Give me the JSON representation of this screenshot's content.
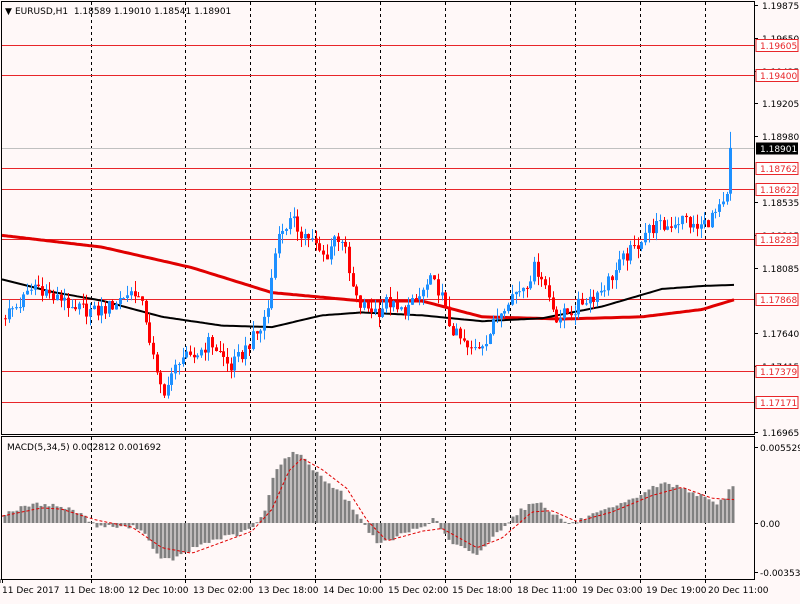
{
  "colors": {
    "background": "#FFF8F8",
    "frame": "#000000",
    "bull": "#1E90FF",
    "bear": "#FF0000",
    "level_line": "#E8262A",
    "ma_slow": "#E00000",
    "ma_fast": "#000000",
    "macd_hist": "#808080",
    "macd_signal": "#E00000",
    "current_price_line": "#C0C0C0",
    "label_bg": "#FFFFFF",
    "current_price_bg": "#000000"
  },
  "header": {
    "arrow": "▼",
    "text": "EURUSD,H1  1.18589 1.19010 1.18541 1.18901"
  },
  "macd_header": {
    "text": "MACD(5,34,5) 0.002812 0.001692"
  },
  "chart_data": [
    {
      "type": "candlestick",
      "symbol": "EURUSD",
      "timeframe": "H1",
      "last_bar": {
        "open": 1.18589,
        "high": 1.1901,
        "low": 1.18541,
        "close": 1.18901
      },
      "y_ticks": [
        "1.19875",
        "1.19650",
        "1.19425",
        "1.19205",
        "1.18980",
        "1.18535",
        "1.18305",
        "1.18085",
        "1.17640",
        "1.17415",
        "1.16965"
      ],
      "current_price": {
        "value": 1.18901,
        "label": "1.18901"
      },
      "levels": [
        {
          "value": 1.19605,
          "label": "1.19605"
        },
        {
          "value": 1.194,
          "label": "1.19400"
        },
        {
          "value": 1.18762,
          "label": "1.18762"
        },
        {
          "value": 1.18622,
          "label": "1.18622"
        },
        {
          "value": 1.18283,
          "label": "1.18283"
        },
        {
          "value": 1.17868,
          "label": "1.17868"
        },
        {
          "value": 1.17379,
          "label": "1.17379"
        },
        {
          "value": 1.17171,
          "label": "1.17171"
        }
      ],
      "x_labels": [
        "11 Dec 2017",
        "11 Dec 18:00",
        "12 Dec 10:00",
        "13 Dec 02:00",
        "13 Dec 18:00",
        "14 Dec 10:00",
        "15 Dec 02:00",
        "15 Dec 18:00",
        "18 Dec 11:00",
        "19 Dec 03:00",
        "19 Dec 19:00",
        "20 Dec 11:00"
      ],
      "price_path": [
        [
          0,
          1.1774
        ],
        [
          10,
          1.1779
        ],
        [
          20,
          1.1784
        ],
        [
          35,
          1.1797
        ],
        [
          45,
          1.1793
        ],
        [
          55,
          1.1786
        ],
        [
          65,
          1.1789
        ],
        [
          72,
          1.1776
        ],
        [
          80,
          1.1781
        ],
        [
          95,
          1.1778
        ],
        [
          110,
          1.1782
        ],
        [
          125,
          1.179
        ],
        [
          135,
          1.1793
        ],
        [
          145,
          1.1776
        ],
        [
          150,
          1.1757
        ],
        [
          158,
          1.1729
        ],
        [
          165,
          1.1725
        ],
        [
          172,
          1.1734
        ],
        [
          180,
          1.1749
        ],
        [
          190,
          1.1745
        ],
        [
          200,
          1.1752
        ],
        [
          210,
          1.1758
        ],
        [
          220,
          1.175
        ],
        [
          230,
          1.174
        ],
        [
          240,
          1.1748
        ],
        [
          250,
          1.1758
        ],
        [
          260,
          1.1766
        ],
        [
          268,
          1.1782
        ],
        [
          275,
          1.1823
        ],
        [
          283,
          1.1836
        ],
        [
          292,
          1.184
        ],
        [
          300,
          1.1833
        ],
        [
          310,
          1.1829
        ],
        [
          318,
          1.182
        ],
        [
          325,
          1.1815
        ],
        [
          335,
          1.183
        ],
        [
          343,
          1.1828
        ],
        [
          350,
          1.18
        ],
        [
          358,
          1.1783
        ],
        [
          368,
          1.1781
        ],
        [
          378,
          1.1779
        ],
        [
          388,
          1.1786
        ],
        [
          398,
          1.1778
        ],
        [
          410,
          1.1782
        ],
        [
          420,
          1.1789
        ],
        [
          430,
          1.1799
        ],
        [
          440,
          1.1793
        ],
        [
          447,
          1.1773
        ],
        [
          455,
          1.1763
        ],
        [
          462,
          1.1758
        ],
        [
          470,
          1.1751
        ],
        [
          478,
          1.1755
        ],
        [
          488,
          1.1762
        ],
        [
          498,
          1.1776
        ],
        [
          508,
          1.1788
        ],
        [
          518,
          1.1793
        ],
        [
          527,
          1.1799
        ],
        [
          535,
          1.1809
        ],
        [
          542,
          1.1803
        ],
        [
          550,
          1.1786
        ],
        [
          557,
          1.1774
        ],
        [
          565,
          1.1777
        ],
        [
          575,
          1.178
        ],
        [
          585,
          1.1787
        ],
        [
          595,
          1.179
        ],
        [
          605,
          1.1797
        ],
        [
          615,
          1.1806
        ],
        [
          625,
          1.1816
        ],
        [
          635,
          1.1822
        ],
        [
          645,
          1.1833
        ],
        [
          655,
          1.1837
        ],
        [
          665,
          1.1836
        ],
        [
          675,
          1.184
        ],
        [
          685,
          1.1842
        ],
        [
          695,
          1.1834
        ],
        [
          705,
          1.1839
        ],
        [
          715,
          1.1845
        ],
        [
          722,
          1.1849
        ],
        [
          728,
          1.1858
        ],
        [
          732,
          1.189
        ]
      ],
      "ma_slow": [
        [
          0,
          1.18305
        ],
        [
          100,
          1.18225
        ],
        [
          190,
          1.18085
        ],
        [
          270,
          1.17915
        ],
        [
          360,
          1.17858
        ],
        [
          420,
          1.17858
        ],
        [
          480,
          1.1775
        ],
        [
          560,
          1.17735
        ],
        [
          640,
          1.1775
        ],
        [
          700,
          1.178
        ],
        [
          733,
          1.17868
        ]
      ],
      "ma_fast": [
        [
          0,
          1.18005
        ],
        [
          50,
          1.1792
        ],
        [
          100,
          1.1786
        ],
        [
          160,
          1.1775
        ],
        [
          220,
          1.1769
        ],
        [
          270,
          1.1768
        ],
        [
          320,
          1.1776
        ],
        [
          360,
          1.1778
        ],
        [
          420,
          1.1776
        ],
        [
          480,
          1.1772
        ],
        [
          540,
          1.1774
        ],
        [
          600,
          1.1782
        ],
        [
          660,
          1.1794
        ],
        [
          700,
          1.1796
        ],
        [
          733,
          1.17968
        ]
      ]
    },
    {
      "type": "macd",
      "name": "MACD(5,34,5)",
      "value": 0.002812,
      "signal": 0.001692,
      "y_ticks": [
        "0.005529",
        "0.00",
        "-0.003536"
      ],
      "macd_path": [
        [
          0,
          0.0006
        ],
        [
          30,
          0.0013
        ],
        [
          45,
          0.0014
        ],
        [
          60,
          0.0012
        ],
        [
          80,
          0.0008
        ],
        [
          95,
          -0.0002
        ],
        [
          120,
          -0.0003
        ],
        [
          140,
          -0.0003
        ],
        [
          152,
          -0.0016
        ],
        [
          160,
          -0.0027
        ],
        [
          175,
          -0.0026
        ],
        [
          200,
          -0.0016
        ],
        [
          220,
          -0.0011
        ],
        [
          240,
          -0.0008
        ],
        [
          255,
          -0.0002
        ],
        [
          265,
          0.0008
        ],
        [
          275,
          0.0039
        ],
        [
          287,
          0.0048
        ],
        [
          296,
          0.0052
        ],
        [
          310,
          0.0042
        ],
        [
          325,
          0.0031
        ],
        [
          340,
          0.0023
        ],
        [
          352,
          0.0012
        ],
        [
          365,
          -0.0002
        ],
        [
          380,
          -0.0016
        ],
        [
          400,
          -0.0009
        ],
        [
          420,
          -0.0003
        ],
        [
          435,
          0.0003
        ],
        [
          450,
          -0.0014
        ],
        [
          462,
          -0.0018
        ],
        [
          475,
          -0.0024
        ],
        [
          490,
          -0.0013
        ],
        [
          505,
          -0.0001
        ],
        [
          520,
          0.0009
        ],
        [
          538,
          0.0016
        ],
        [
          555,
          0.0006
        ],
        [
          570,
          -0.0001
        ],
        [
          590,
          0.0005
        ],
        [
          610,
          0.001
        ],
        [
          630,
          0.0016
        ],
        [
          650,
          0.0025
        ],
        [
          665,
          0.0029
        ],
        [
          685,
          0.0025
        ],
        [
          700,
          0.002
        ],
        [
          715,
          0.0014
        ],
        [
          725,
          0.0018
        ],
        [
          732,
          0.0028
        ]
      ],
      "signal_path": [
        [
          0,
          0.0005
        ],
        [
          40,
          0.0011
        ],
        [
          60,
          0.001
        ],
        [
          95,
          0.0002
        ],
        [
          130,
          -0.0003
        ],
        [
          160,
          -0.0018
        ],
        [
          190,
          -0.0022
        ],
        [
          220,
          -0.0014
        ],
        [
          250,
          -0.0006
        ],
        [
          270,
          0.001
        ],
        [
          287,
          0.0038
        ],
        [
          300,
          0.0047
        ],
        [
          320,
          0.0039
        ],
        [
          345,
          0.0025
        ],
        [
          365,
          0.0002
        ],
        [
          385,
          -0.0013
        ],
        [
          420,
          -0.0006
        ],
        [
          440,
          -0.0004
        ],
        [
          475,
          -0.0018
        ],
        [
          500,
          -0.0011
        ],
        [
          530,
          0.0008
        ],
        [
          550,
          0.0009
        ],
        [
          575,
          0.0001
        ],
        [
          610,
          0.0008
        ],
        [
          650,
          0.002
        ],
        [
          680,
          0.0026
        ],
        [
          710,
          0.0018
        ],
        [
          732,
          0.0017
        ]
      ]
    }
  ]
}
